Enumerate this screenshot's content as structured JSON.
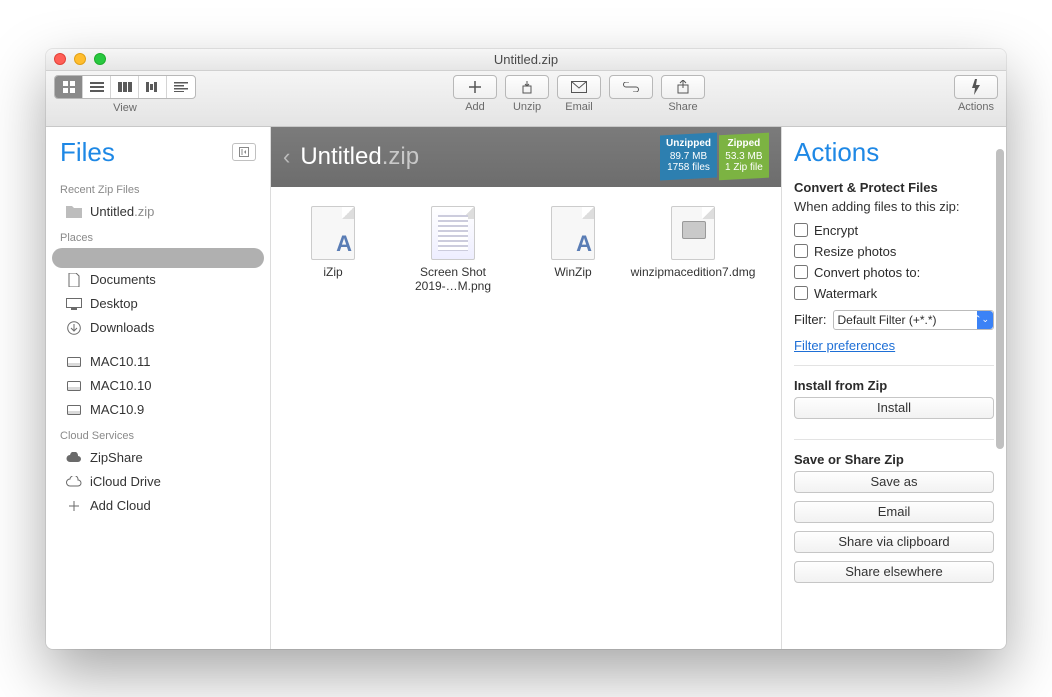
{
  "window": {
    "title": "Untitled.zip"
  },
  "toolbar": {
    "view_label": "View",
    "buttons": {
      "add": "Add",
      "unzip": "Unzip",
      "email": "Email",
      "share": "Share",
      "actions": "Actions"
    }
  },
  "sidebar": {
    "title": "Files",
    "recent_label": "Recent Zip Files",
    "recent": [
      {
        "name": "Untitled",
        "ext": ".zip"
      }
    ],
    "places_label": "Places",
    "places": [
      {
        "name": "",
        "selected": true,
        "icon": "blank"
      },
      {
        "name": "Documents",
        "icon": "doc"
      },
      {
        "name": "Desktop",
        "icon": "desktop"
      },
      {
        "name": "Downloads",
        "icon": "download"
      }
    ],
    "volumes": [
      {
        "name": "MAC10.11"
      },
      {
        "name": "MAC10.10"
      },
      {
        "name": "MAC10.9"
      }
    ],
    "cloud_label": "Cloud Services",
    "clouds": [
      {
        "name": "ZipShare",
        "icon": "cloud-solid"
      },
      {
        "name": "iCloud Drive",
        "icon": "cloud-outline"
      },
      {
        "name": "Add Cloud",
        "icon": "plus"
      }
    ]
  },
  "main": {
    "title": "Untitled",
    "ext": ".zip",
    "stats": {
      "unzipped_label": "Unzipped",
      "zipped_label": "Zipped",
      "unzipped_size": "89.7 MB",
      "unzipped_files": "1758 files",
      "zipped_size": "53.3 MB",
      "zipped_files": "1 Zip file"
    },
    "files": [
      {
        "name": "iZip",
        "type": "app"
      },
      {
        "name": "Screen Shot 2019-…M.png",
        "type": "image"
      },
      {
        "name": "WinZip",
        "type": "app"
      },
      {
        "name": "winzipmacedition7.dmg",
        "type": "dmg"
      }
    ]
  },
  "actions": {
    "title": "Actions",
    "convert_header": "Convert & Protect Files",
    "convert_sub": "When adding files to this zip:",
    "encrypt": "Encrypt",
    "resize": "Resize photos",
    "convert_photos": "Convert photos to:",
    "watermark": "Watermark",
    "filter_label": "Filter:",
    "filter_value": "Default Filter (+*.*)",
    "filter_prefs": "Filter preferences",
    "install_header": "Install from Zip",
    "install_btn": "Install",
    "save_header": "Save or Share Zip",
    "save_as": "Save as",
    "email": "Email",
    "share_clip": "Share via clipboard",
    "share_else": "Share elsewhere"
  }
}
